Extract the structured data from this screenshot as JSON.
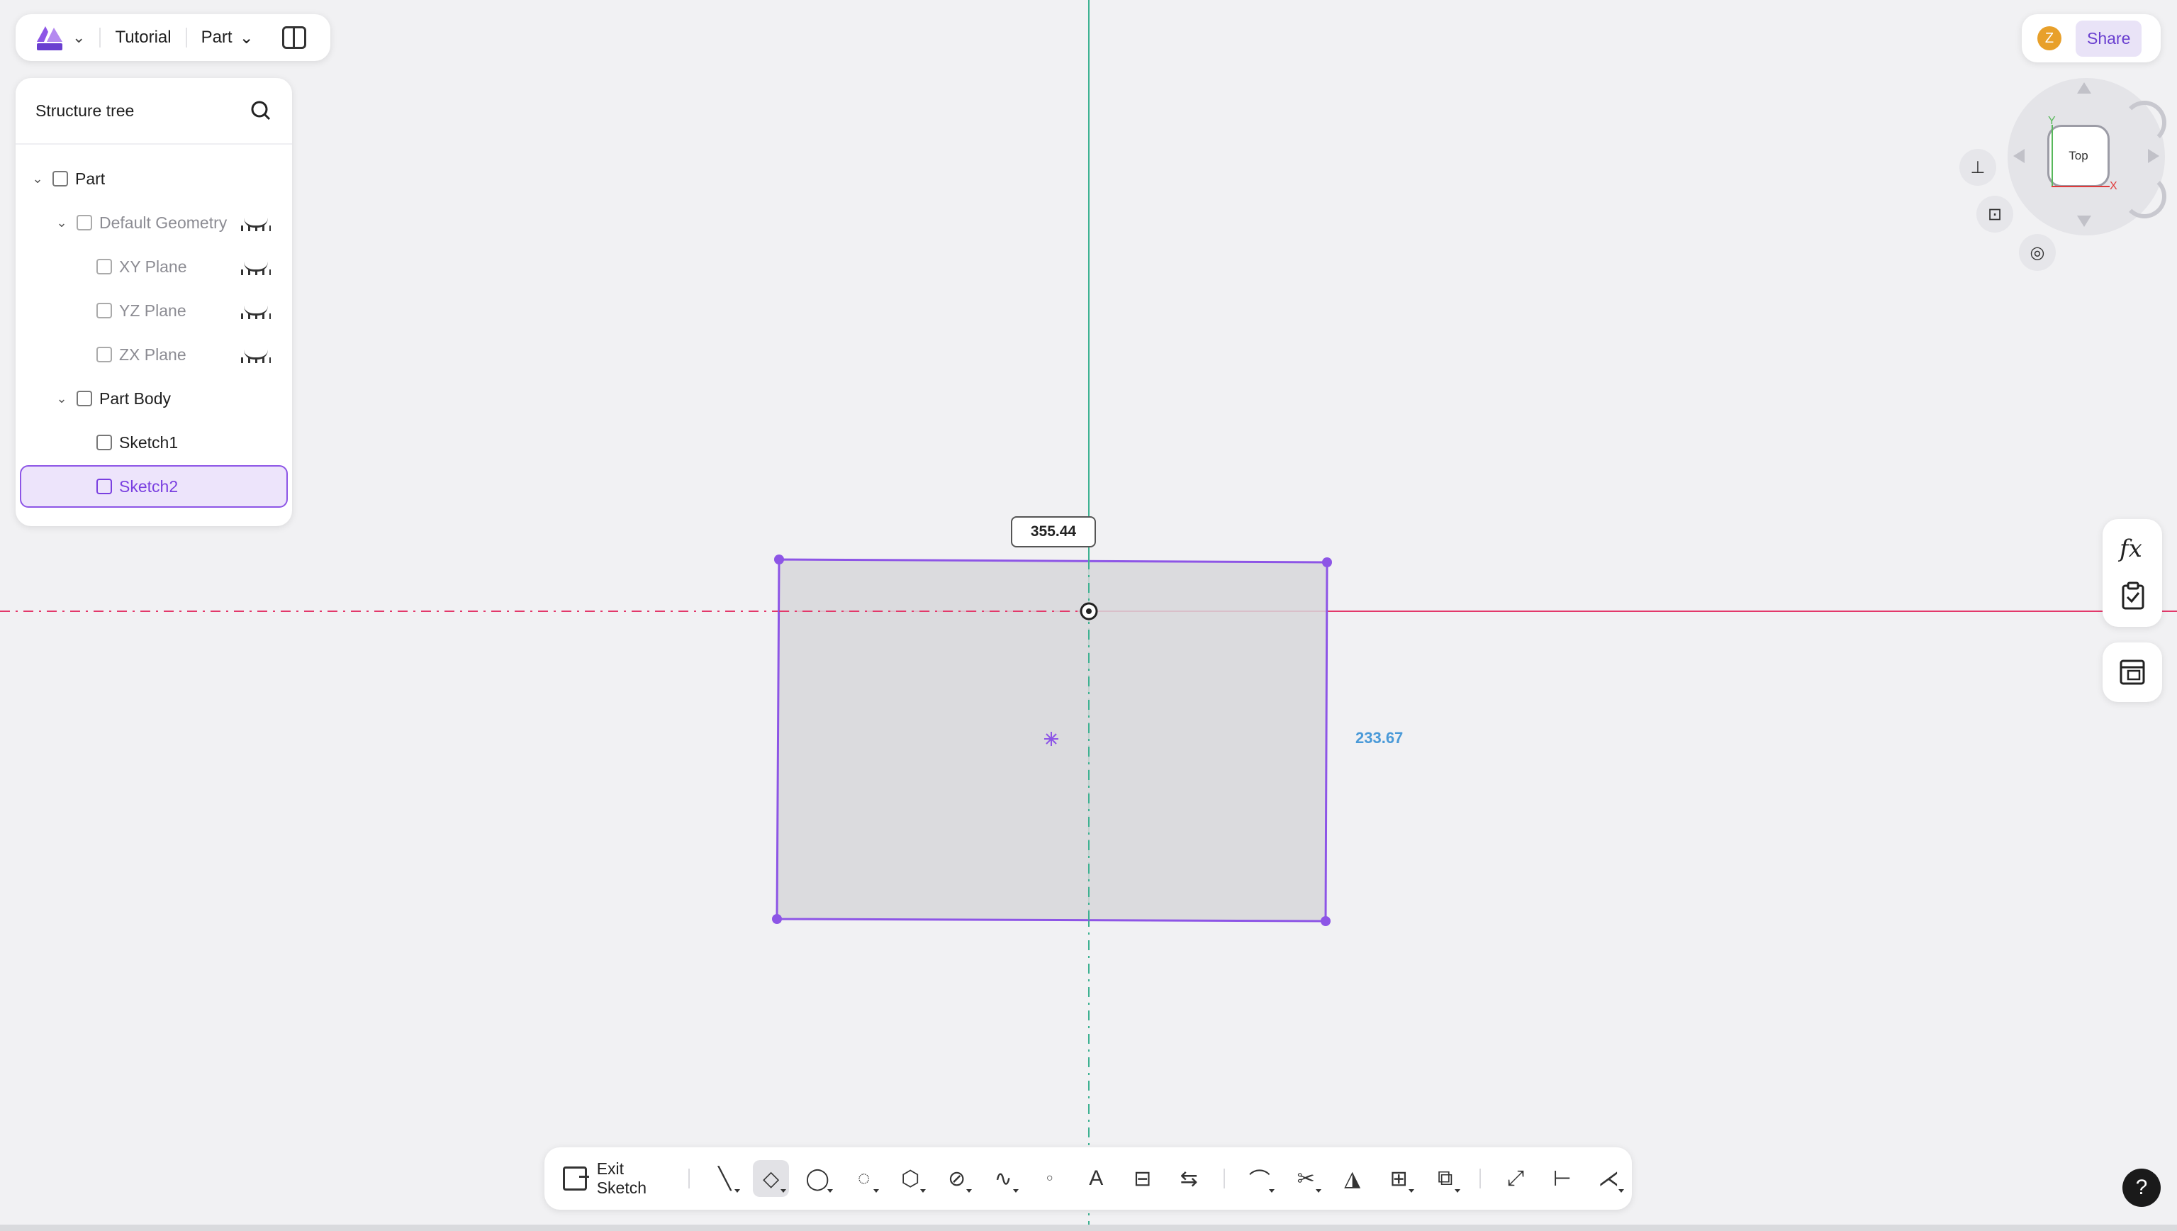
{
  "topbar": {
    "project": "Tutorial",
    "mode": "Part"
  },
  "tree": {
    "title": "Structure tree",
    "items": [
      {
        "label": "Part"
      },
      {
        "label": "Default Geometry"
      },
      {
        "label": "XY Plane"
      },
      {
        "label": "YZ Plane"
      },
      {
        "label": "ZX Plane"
      },
      {
        "label": "Part Body"
      },
      {
        "label": "Sketch1"
      },
      {
        "label": "Sketch2",
        "selected": true
      }
    ]
  },
  "share": {
    "avatar_initial": "Z",
    "label": "Share"
  },
  "viewcube": {
    "face": "Top",
    "axis_x": "X",
    "axis_y": "Y"
  },
  "side_panel": {
    "formula_label": "fx"
  },
  "sketch": {
    "width_dimension": "355.44",
    "height_dimension": "233.67"
  },
  "bottom_toolbar": {
    "exit_label": "Exit Sketch",
    "tools": [
      "line-tool-icon",
      "rectangle-tool-icon",
      "circle-tool-icon",
      "arc-tool-icon",
      "polygon-tool-icon",
      "slot-tool-icon",
      "spline-tool-icon",
      "point-tool-icon",
      "text-tool-icon",
      "project-tool-icon",
      "convert-tool-icon",
      "fillet-tool-icon",
      "trim-tool-icon",
      "mirror-tool-icon",
      "pattern-tool-icon",
      "transform-tool-icon",
      "offset-tool-icon",
      "dimension-tool-icon",
      "constraint-tool-icon"
    ]
  },
  "help": {
    "label": "?"
  },
  "colors": {
    "accent": "#8d55e6",
    "sketch_fill": "#d7d7d9",
    "axis_red": "#e3386a",
    "axis_green": "#3fb292"
  }
}
